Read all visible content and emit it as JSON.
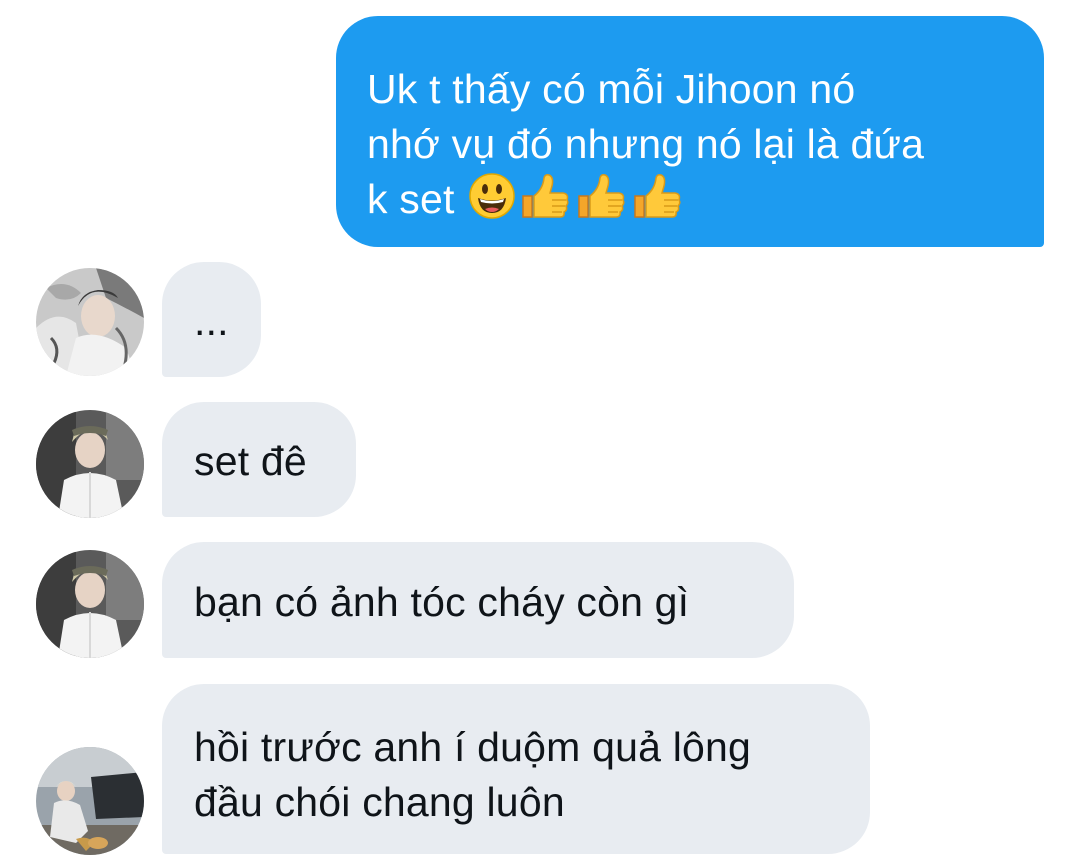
{
  "messages": {
    "outgoing": {
      "lines": [
        "Uk t thấy có mỗi Jihoon nó",
        "nhớ vụ đó nhưng nó lại là đứa",
        "k set"
      ],
      "emojis": [
        "grinning-face-icon",
        "thumbs-up-icon",
        "thumbs-up-icon",
        "thumbs-up-icon"
      ]
    },
    "incoming": [
      {
        "text": "...",
        "avatar": "avatar-user-1"
      },
      {
        "text": "set đê",
        "avatar": "avatar-user-2"
      },
      {
        "text": "bạn có ảnh tóc cháy còn gì",
        "avatar": "avatar-user-2"
      },
      {
        "lines": [
          "hồi trước anh í duộm quả lông",
          "đầu chói chang luôn"
        ],
        "avatar": "avatar-user-3"
      }
    ]
  },
  "colors": {
    "outgoing_bubble": "#1d9bf0",
    "incoming_bubble": "#e8ecf1",
    "incoming_text": "#0f1419",
    "outgoing_text": "#ffffff"
  }
}
